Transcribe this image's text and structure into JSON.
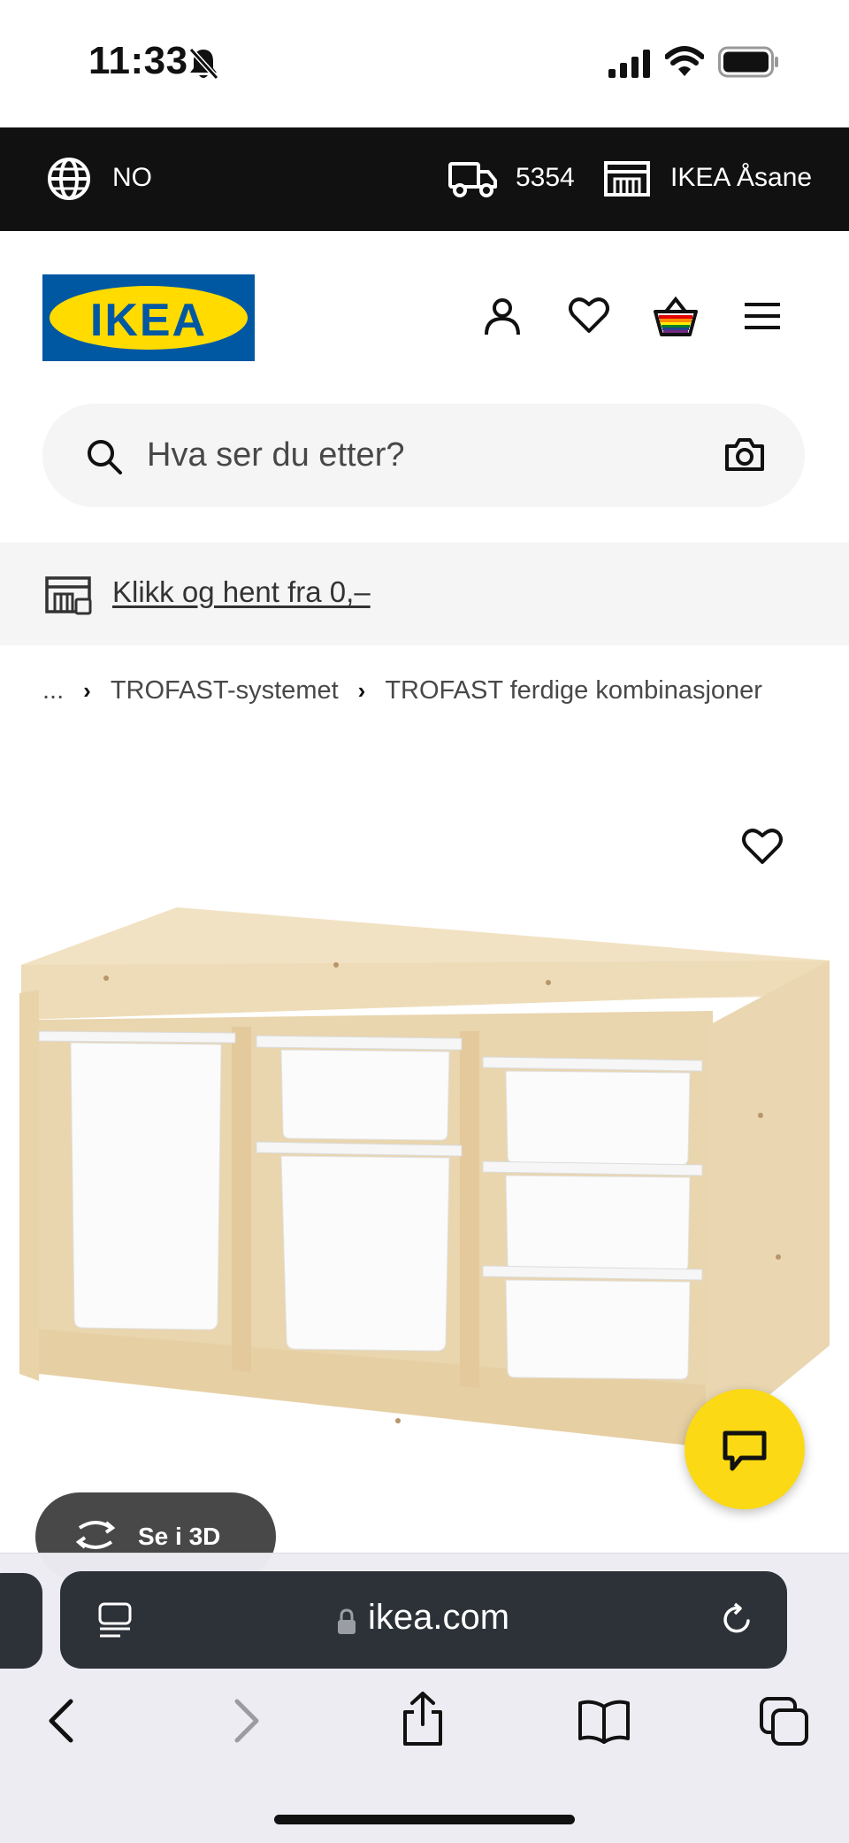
{
  "status_bar": {
    "time": "11:33"
  },
  "top_bar": {
    "region": "NO",
    "postcode": "5354",
    "store": "IKEA Åsane"
  },
  "header": {
    "logo_text": "IKEA",
    "icons": [
      "account-icon",
      "heart-icon",
      "basket-icon",
      "menu-icon"
    ]
  },
  "search": {
    "placeholder": "Hva ser du etter?"
  },
  "promo": {
    "link_text": "Klikk og hent fra 0,–"
  },
  "breadcrumb": {
    "items": [
      "...",
      "TROFAST-systemet",
      "TROFAST ferdige kombinasjoner"
    ]
  },
  "product": {
    "image": "trofast-storage-combination",
    "view_3d_label": "Se i 3D"
  },
  "browser": {
    "url": "ikea.com"
  },
  "colors": {
    "brand_blue": "#0058a3",
    "brand_yellow": "#ffdb00",
    "chat_yellow": "#fbd914",
    "top_bar": "#111111"
  }
}
